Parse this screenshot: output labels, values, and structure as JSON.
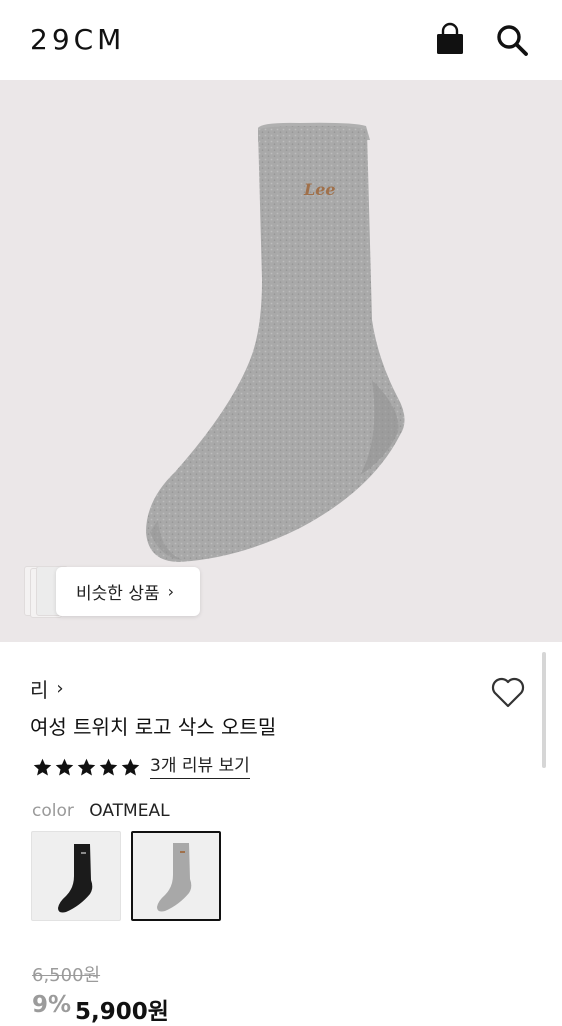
{
  "header": {
    "logo": "29CM",
    "icons": [
      "shopping-bag-icon",
      "search-icon"
    ]
  },
  "hero": {
    "similar_label": "비슷한 상품",
    "similar_chevron": "›",
    "sock_logo": "Lee"
  },
  "product": {
    "brand": "리",
    "brand_chevron": "›",
    "title": "여성 트위치 로고 삭스 오트밀",
    "rating_stars": 5,
    "review_link": "3개 리뷰 보기",
    "color_label": "color",
    "color_value": "OATMEAL",
    "swatches": [
      {
        "name": "black",
        "selected": false
      },
      {
        "name": "oatmeal",
        "selected": true
      }
    ],
    "original_price": "6,500원",
    "discount": "9%",
    "sale_price": "5,900원"
  },
  "colors": {
    "hero_bg": "#ebe7e8",
    "sock_gray": "#a7a7a7",
    "logo_brown": "#a0704a",
    "text_muted": "#9b9b9b"
  }
}
